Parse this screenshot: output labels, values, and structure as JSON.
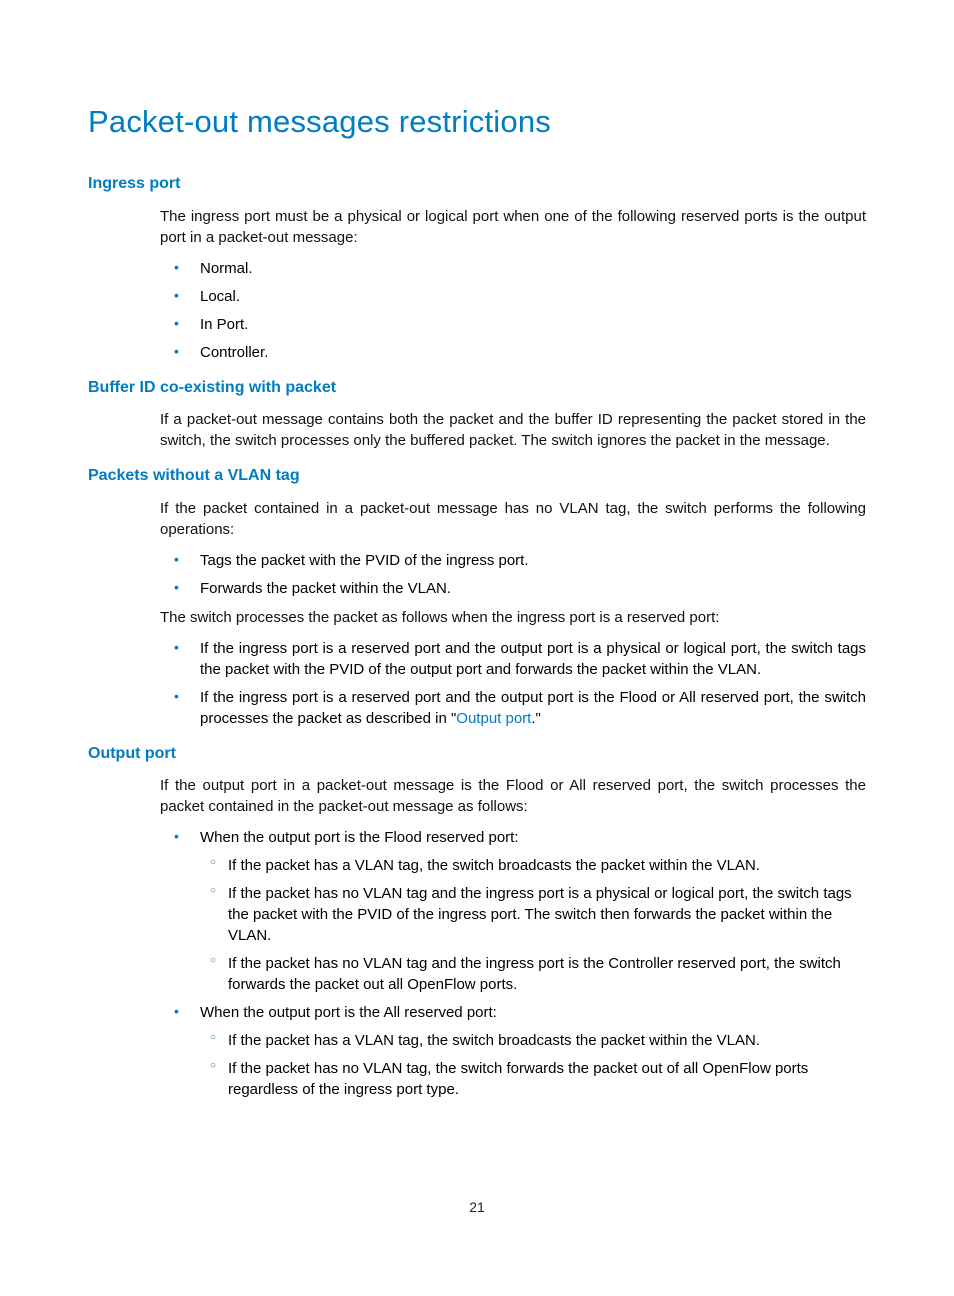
{
  "title": "Packet-out messages restrictions",
  "s1": {
    "heading": "Ingress port",
    "intro": "The ingress port must be a physical or logical port  when one of the following reserved ports is the output port in a packet-out message:",
    "b1": "Normal.",
    "b2": "Local.",
    "b3": "In Port.",
    "b4": "Controller."
  },
  "s2": {
    "heading": "Buffer ID co-existing with packet",
    "p1": "If a packet-out message contains both the packet and the buffer ID representing the packet stored in the switch, the switch processes only the buffered packet. The switch ignores the packet in the message."
  },
  "s3": {
    "heading": "Packets without a VLAN tag",
    "p1": "If the packet contained in a packet-out message has no VLAN tag, the switch performs the following operations:",
    "b1": "Tags the packet with the PVID of the ingress port.",
    "b2": "Forwards the packet within the VLAN.",
    "p2": "The switch processes the packet as follows when the ingress port is a reserved port:",
    "b3": "If the ingress port is a reserved port and the output port is a physical or logical port, the switch tags the packet with the PVID of the output port and forwards the packet within the VLAN.",
    "b4a": "If the ingress port is a reserved port and the output port is the Flood or All reserved port, the switch processes the packet as described in \"",
    "b4link": "Output port",
    "b4b": ".\""
  },
  "s4": {
    "heading": "Output port",
    "p1": "If the output port in a packet-out message is the Flood or All reserved port, the switch processes the packet contained in the packet-out message as follows:",
    "b1": "When the output port is the Flood reserved port:",
    "b1s1": "If the packet has a VLAN tag, the switch broadcasts the packet within the VLAN.",
    "b1s2": "If the packet has no VLAN tag and the ingress port is a physical or logical port, the switch tags the packet with the PVID of the ingress port. The switch then forwards the packet within the VLAN.",
    "b1s3": "If the packet has no VLAN tag and the ingress port is the Controller reserved port, the switch forwards the packet out all OpenFlow ports.",
    "b2": "When the output port is the All reserved port:",
    "b2s1": "If the packet has a VLAN tag, the switch broadcasts the packet within the VLAN.",
    "b2s2": "If the packet has no VLAN tag, the switch forwards the packet out of all OpenFlow ports regardless of the ingress port type."
  },
  "page_number": "21"
}
